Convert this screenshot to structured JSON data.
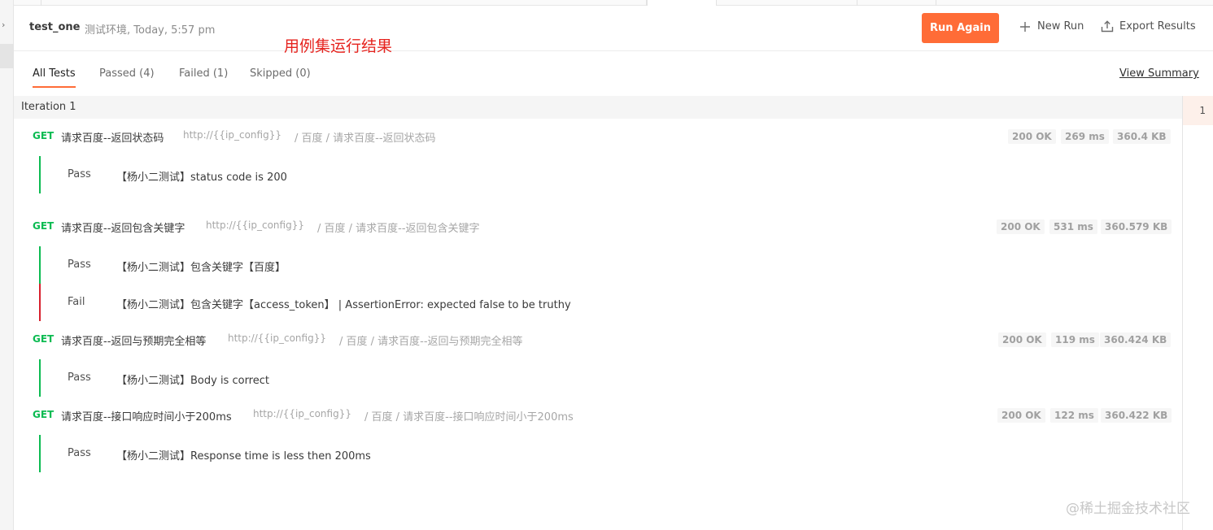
{
  "header": {
    "run_name": "test_one",
    "run_meta": "测试环境, Today, 5:57 pm",
    "annotation": "用例集运行结果",
    "run_again": "Run Again",
    "new_run": "New Run",
    "export_results": "Export Results"
  },
  "filters": {
    "all_tests": "All Tests",
    "passed": "Passed (4)",
    "failed": "Failed (1)",
    "skipped": "Skipped (0)",
    "view_summary": "View Summary"
  },
  "iteration": {
    "label": "Iteration 1",
    "number": "1"
  },
  "requests": [
    {
      "method": "GET",
      "name": "请求百度--返回状态码",
      "url": "http://{{ip_config}}",
      "path": "/ 百度 / 请求百度--返回状态码",
      "status": "200 OK",
      "time": "269 ms",
      "size": "360.4 KB",
      "tests": [
        {
          "result": "Pass",
          "name": "【杨小二测试】status code is 200"
        }
      ]
    },
    {
      "method": "GET",
      "name": "请求百度--返回包含关键字",
      "url": "http://{{ip_config}}",
      "path": "/ 百度 / 请求百度--返回包含关键字",
      "status": "200 OK",
      "time": "531 ms",
      "size": "360.579 KB",
      "tests": [
        {
          "result": "Pass",
          "name": "【杨小二测试】包含关键字【百度】"
        },
        {
          "result": "Fail",
          "name": "【杨小二测试】包含关键字【access_token】 | AssertionError: expected false to be truthy"
        }
      ]
    },
    {
      "method": "GET",
      "name": "请求百度--返回与预期完全相等",
      "url": "http://{{ip_config}}",
      "path": "/ 百度 / 请求百度--返回与预期完全相等",
      "status": "200 OK",
      "time": "119 ms",
      "size": "360.424 KB",
      "tests": [
        {
          "result": "Pass",
          "name": "【杨小二测试】Body is correct"
        }
      ]
    },
    {
      "method": "GET",
      "name": "请求百度--接口响应时间小于200ms",
      "url": "http://{{ip_config}}",
      "path": "/ 百度 / 请求百度--接口响应时间小于200ms",
      "status": "200 OK",
      "time": "122 ms",
      "size": "360.422 KB",
      "tests": [
        {
          "result": "Pass",
          "name": "【杨小二测试】Response time is less then 200ms"
        }
      ]
    }
  ],
  "watermark": "@稀土掘金技术社区",
  "colors": {
    "accent": "#ff6c37",
    "get_method": "#0cbb52",
    "pass_bar": "#0cbb52",
    "fail_bar": "#d7202d",
    "annotation": "#e6231e"
  }
}
